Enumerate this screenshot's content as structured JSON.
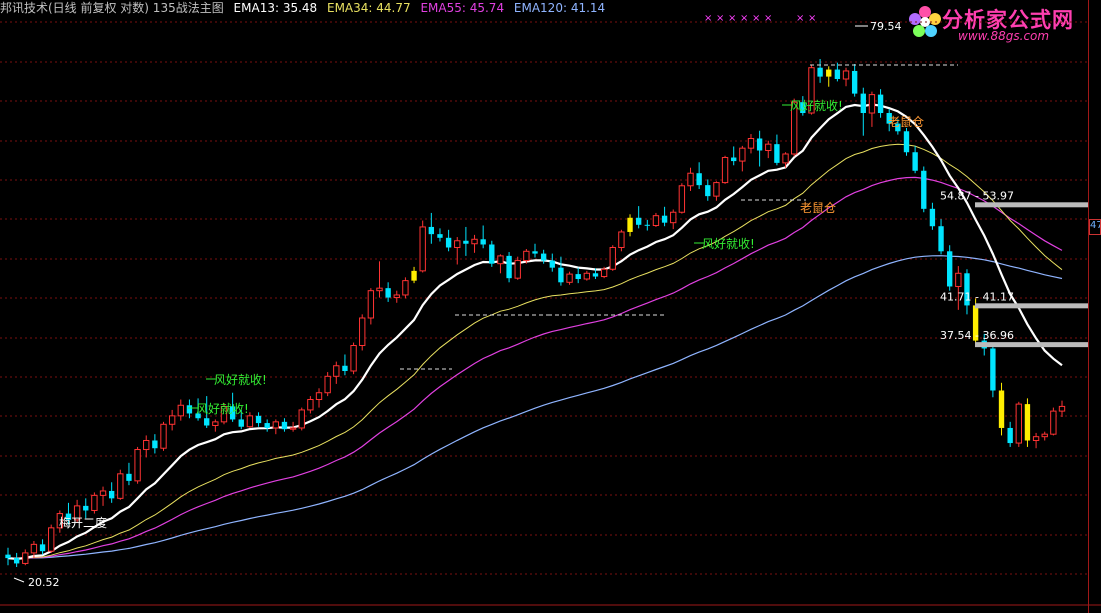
{
  "header": {
    "title": "邦讯技术(日线 前复权 对数) 135战法主图",
    "ema13_label": "EMA13: 35.48",
    "ema34_label": "EMA34: 44.77",
    "ema55_label": "EMA55: 45.74",
    "ema120_label": "EMA120: 41.14"
  },
  "logo": {
    "text": "分析家公式网",
    "url": "www.88gs.com"
  },
  "right_axis_box": "47",
  "colors": {
    "background": "#000000",
    "grid": "#7a1010",
    "candle_up": "#ff3333",
    "candle_down": "#00e5ff",
    "highlight": "#ffee00",
    "ema13": "#ffffff",
    "ema34": "#e8e060",
    "ema55": "#e040e0",
    "ema120": "#8fb4ff",
    "signal_green": "#33ee33",
    "signal_orange": "#ff9933",
    "zone_bar": "#bbbbbb"
  },
  "chart_data": {
    "type": "candlestick",
    "title": "邦讯技术(日线 前复权 对数) 135战法主图",
    "scale": "log",
    "ylim": [
      19,
      90
    ],
    "grid": "horizontal dotted",
    "candles": [
      [
        21.2,
        21.6,
        20.6,
        21.0
      ],
      [
        21.0,
        21.3,
        20.5,
        20.7
      ],
      [
        20.7,
        21.5,
        20.6,
        21.3
      ],
      [
        21.3,
        22.0,
        21.0,
        21.8
      ],
      [
        21.8,
        22.1,
        21.2,
        21.4
      ],
      [
        21.4,
        23.0,
        21.3,
        22.8
      ],
      [
        22.8,
        23.9,
        22.5,
        23.7
      ],
      [
        23.7,
        24.4,
        23.0,
        23.3
      ],
      [
        23.3,
        24.6,
        23.1,
        24.2
      ],
      [
        24.2,
        24.7,
        23.4,
        23.9
      ],
      [
        23.9,
        25.1,
        23.7,
        24.9
      ],
      [
        24.9,
        25.5,
        24.2,
        25.2
      ],
      [
        25.2,
        25.8,
        24.4,
        24.7
      ],
      [
        24.7,
        26.7,
        24.6,
        26.4
      ],
      [
        26.4,
        27.2,
        25.6,
        25.9
      ],
      [
        25.9,
        28.4,
        25.7,
        28.2
      ],
      [
        28.2,
        29.3,
        27.6,
        28.9
      ],
      [
        28.9,
        29.4,
        27.9,
        28.3
      ],
      [
        28.3,
        30.4,
        28.1,
        30.2
      ],
      [
        30.2,
        31.4,
        29.7,
        30.9
      ],
      [
        30.9,
        32.3,
        30.5,
        31.8
      ],
      [
        31.8,
        32.3,
        30.7,
        31.1
      ],
      [
        31.1,
        32.4,
        30.5,
        30.7
      ],
      [
        30.7,
        32.6,
        29.9,
        30.1
      ],
      [
        30.1,
        30.6,
        29.6,
        30.4
      ],
      [
        30.4,
        32.0,
        30.2,
        31.7
      ],
      [
        31.7,
        32.9,
        30.4,
        30.6
      ],
      [
        30.6,
        31.4,
        29.8,
        30.0
      ],
      [
        30.0,
        31.2,
        29.9,
        30.9
      ],
      [
        30.9,
        31.2,
        30.0,
        30.3
      ],
      [
        30.3,
        30.6,
        29.6,
        29.9
      ],
      [
        29.9,
        30.6,
        29.4,
        30.4
      ],
      [
        30.4,
        30.7,
        29.6,
        29.8
      ],
      [
        29.8,
        30.4,
        29.6,
        29.9
      ],
      [
        29.9,
        31.6,
        29.7,
        31.4
      ],
      [
        31.4,
        32.6,
        31.1,
        32.3
      ],
      [
        32.3,
        33.3,
        31.6,
        32.9
      ],
      [
        32.9,
        34.8,
        32.6,
        34.4
      ],
      [
        34.4,
        35.8,
        33.7,
        35.4
      ],
      [
        35.4,
        36.5,
        34.5,
        34.9
      ],
      [
        34.9,
        37.7,
        34.6,
        37.4
      ],
      [
        37.4,
        40.7,
        36.9,
        40.3
      ],
      [
        40.3,
        43.7,
        39.6,
        43.4
      ],
      [
        43.4,
        47.0,
        42.6,
        43.7
      ],
      [
        43.7,
        44.4,
        42.1,
        42.6
      ],
      [
        42.6,
        43.4,
        42.0,
        42.9
      ],
      [
        42.9,
        45.0,
        42.5,
        44.6
      ],
      [
        44.6,
        46.3,
        44.3,
        45.8
      ],
      [
        45.8,
        52.5,
        45.6,
        51.6
      ],
      [
        51.6,
        53.6,
        49.3,
        50.6
      ],
      [
        50.6,
        51.4,
        49.6,
        50.1
      ],
      [
        50.1,
        51.2,
        48.3,
        48.8
      ],
      [
        48.8,
        50.2,
        46.6,
        49.7
      ],
      [
        49.7,
        51.6,
        47.7,
        49.3
      ],
      [
        49.3,
        50.5,
        48.1,
        49.9
      ],
      [
        49.9,
        51.8,
        48.7,
        49.2
      ],
      [
        49.2,
        49.7,
        46.3,
        46.7
      ],
      [
        46.7,
        47.9,
        45.5,
        47.7
      ],
      [
        47.7,
        48.2,
        44.4,
        44.9
      ],
      [
        44.9,
        47.6,
        44.7,
        47.1
      ],
      [
        47.1,
        48.6,
        46.7,
        48.3
      ],
      [
        48.3,
        49.3,
        47.5,
        48.0
      ],
      [
        48.0,
        48.5,
        46.7,
        47.1
      ],
      [
        47.1,
        48.0,
        45.7,
        46.2
      ],
      [
        46.2,
        47.6,
        44.0,
        44.4
      ],
      [
        44.4,
        45.7,
        44.1,
        45.4
      ],
      [
        45.4,
        46.2,
        44.3,
        44.8
      ],
      [
        44.8,
        45.8,
        44.6,
        45.5
      ],
      [
        45.5,
        46.1,
        44.8,
        45.1
      ],
      [
        45.1,
        46.3,
        44.9,
        46.0
      ],
      [
        46.0,
        49.1,
        45.8,
        48.8
      ],
      [
        48.8,
        51.2,
        48.3,
        50.9
      ],
      [
        50.9,
        53.4,
        50.3,
        52.9
      ],
      [
        52.9,
        54.6,
        51.4,
        51.9
      ],
      [
        51.9,
        52.6,
        51.1,
        51.8
      ],
      [
        51.8,
        53.6,
        51.6,
        53.2
      ],
      [
        53.2,
        54.5,
        51.7,
        52.2
      ],
      [
        52.2,
        54.1,
        51.3,
        53.7
      ],
      [
        53.7,
        58.1,
        53.5,
        57.7
      ],
      [
        57.7,
        60.6,
        56.9,
        59.7
      ],
      [
        59.7,
        61.5,
        57.2,
        57.8
      ],
      [
        57.8,
        58.7,
        55.4,
        56.1
      ],
      [
        56.1,
        58.4,
        55.4,
        58.2
      ],
      [
        58.2,
        62.6,
        58.0,
        62.3
      ],
      [
        62.3,
        64.2,
        61.0,
        61.7
      ],
      [
        61.7,
        64.3,
        60.0,
        63.9
      ],
      [
        63.9,
        66.4,
        63.0,
        65.6
      ],
      [
        65.6,
        67.0,
        60.8,
        63.5
      ],
      [
        63.5,
        65.2,
        62.2,
        64.6
      ],
      [
        64.6,
        66.3,
        61.0,
        61.4
      ],
      [
        61.4,
        63.2,
        60.6,
        62.9
      ],
      [
        62.9,
        73.1,
        62.5,
        72.4
      ],
      [
        72.4,
        73.6,
        69.8,
        70.3
      ],
      [
        70.3,
        80.2,
        70.0,
        79.5
      ],
      [
        79.5,
        81.4,
        76.3,
        77.6
      ],
      [
        77.6,
        79.8,
        75.5,
        79.1
      ],
      [
        79.1,
        80.6,
        76.6,
        77.1
      ],
      [
        77.1,
        79.5,
        75.6,
        78.8
      ],
      [
        78.8,
        80.3,
        73.5,
        74.1
      ],
      [
        74.1,
        75.3,
        66.1,
        70.3
      ],
      [
        70.3,
        74.5,
        67.7,
        73.9
      ],
      [
        73.9,
        75.0,
        69.4,
        70.3
      ],
      [
        70.3,
        71.1,
        66.9,
        68.3
      ],
      [
        68.3,
        69.1,
        66.3,
        66.9
      ],
      [
        66.9,
        67.5,
        62.6,
        63.2
      ],
      [
        63.2,
        64.3,
        59.7,
        60.1
      ],
      [
        60.1,
        60.8,
        53.7,
        54.2
      ],
      [
        54.2,
        55.1,
        51.2,
        51.7
      ],
      [
        51.7,
        52.7,
        47.9,
        48.3
      ],
      [
        48.3,
        49.1,
        43.4,
        43.9
      ],
      [
        43.9,
        46.4,
        41.2,
        45.5
      ],
      [
        45.5,
        46.0,
        40.7,
        41.7
      ],
      [
        41.7,
        42.5,
        37.3,
        37.9
      ],
      [
        37.9,
        38.6,
        36.4,
        37.1
      ],
      [
        37.1,
        37.5,
        32.5,
        33.1
      ],
      [
        33.1,
        33.8,
        29.3,
        29.9
      ],
      [
        29.9,
        30.4,
        28.4,
        28.7
      ],
      [
        28.7,
        32.1,
        28.4,
        31.9
      ],
      [
        31.9,
        32.4,
        28.4,
        28.9
      ],
      [
        28.9,
        29.5,
        28.3,
        29.2
      ],
      [
        29.2,
        29.6,
        28.9,
        29.4
      ],
      [
        29.4,
        31.6,
        29.3,
        31.3
      ],
      [
        31.3,
        32.2,
        30.8,
        31.7
      ]
    ],
    "highlight_indices": [
      47,
      72,
      95,
      112,
      115,
      118
    ],
    "ema": [
      {
        "name": "EMA13",
        "last": 35.48
      },
      {
        "name": "EMA34",
        "last": 44.77
      },
      {
        "name": "EMA55",
        "last": 45.74
      },
      {
        "name": "EMA120",
        "last": 41.14
      }
    ],
    "price_labels": {
      "high": "79.54",
      "low": "20.52"
    },
    "signals": [
      {
        "text": "风好就收!",
        "index": 42
      },
      {
        "text": "风好就收!",
        "index": 42
      },
      {
        "text": "风好就收!",
        "index": 72
      },
      {
        "text": "风好就收!",
        "index": 82
      },
      {
        "text": "梅开二度",
        "index": 6
      },
      {
        "text": "老鼠仓",
        "index": 84
      },
      {
        "text": "老鼠仓",
        "index": 102
      }
    ],
    "zones": [
      {
        "label": "54.87 - 53.97",
        "top": 54.87,
        "bottom": 53.97
      },
      {
        "label": "41.71 - 41.17",
        "top": 41.71,
        "bottom": 41.17
      },
      {
        "label": "37.54 - 36.96",
        "top": 37.54,
        "bottom": 36.96
      }
    ],
    "marker_count_top": 6
  }
}
